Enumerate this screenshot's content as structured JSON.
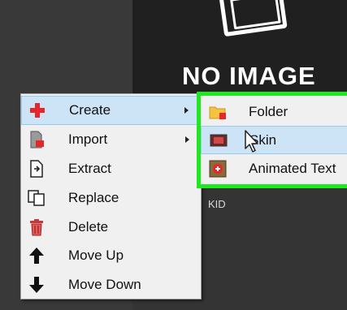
{
  "placeholder": {
    "text": "NO IMAGE",
    "secondary_text": "KID"
  },
  "context_menu": {
    "items": [
      {
        "label": "Create",
        "icon": "plus-icon",
        "has_submenu": true,
        "highlighted": true
      },
      {
        "label": "Import",
        "icon": "import-icon",
        "has_submenu": true
      },
      {
        "label": "Extract",
        "icon": "extract-icon",
        "has_submenu": false
      },
      {
        "label": "Replace",
        "icon": "replace-icon",
        "has_submenu": false
      },
      {
        "label": "Delete",
        "icon": "trash-icon",
        "has_submenu": false
      },
      {
        "label": "Move Up",
        "icon": "arrow-up-icon",
        "has_submenu": false
      },
      {
        "label": "Move Down",
        "icon": "arrow-down-icon",
        "has_submenu": false
      }
    ]
  },
  "submenu": {
    "items": [
      {
        "label": "Folder",
        "icon": "folder-icon"
      },
      {
        "label": "Skin",
        "icon": "skin-icon",
        "highlighted": true
      },
      {
        "label": "Animated Text",
        "icon": "animated-text-icon"
      }
    ]
  },
  "colors": {
    "highlight": "#cde4f7",
    "highlight_border": "#99c9ef",
    "submenu_outline": "#1ee81e",
    "create_icon": "#e8262a"
  }
}
